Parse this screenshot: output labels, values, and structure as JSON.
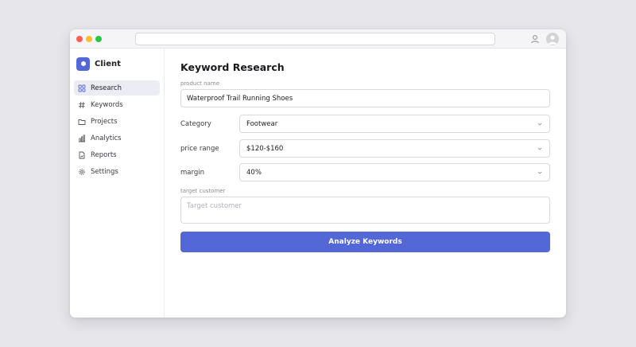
{
  "brand": {
    "name": "Client"
  },
  "sidebar": {
    "items": [
      {
        "label": "Research",
        "icon": "grid-icon",
        "active": true
      },
      {
        "label": "Keywords",
        "icon": "hash-icon"
      },
      {
        "label": "Projects",
        "icon": "folder-icon"
      },
      {
        "label": "Analytics",
        "icon": "bar-chart-icon"
      },
      {
        "label": "Reports",
        "icon": "file-chart-icon"
      },
      {
        "label": "Settings",
        "icon": "gear-icon"
      }
    ]
  },
  "page": {
    "title": "Keyword Research"
  },
  "form": {
    "product_name": {
      "label": "product name",
      "value": "Waterproof Trail Running Shoes"
    },
    "category": {
      "label": "Category",
      "value": "Footwear"
    },
    "price_range": {
      "label": "price range",
      "value": "$120-$160"
    },
    "margin": {
      "label": "margin",
      "value": "40%"
    },
    "target_customer": {
      "label": "target customer",
      "placeholder": "Target customer",
      "value": ""
    },
    "submit_label": "Analyze Keywords"
  },
  "colors": {
    "accent": "#5367d6",
    "active_nav_bg": "#ececf5",
    "page_bg": "#e7e6eb"
  }
}
